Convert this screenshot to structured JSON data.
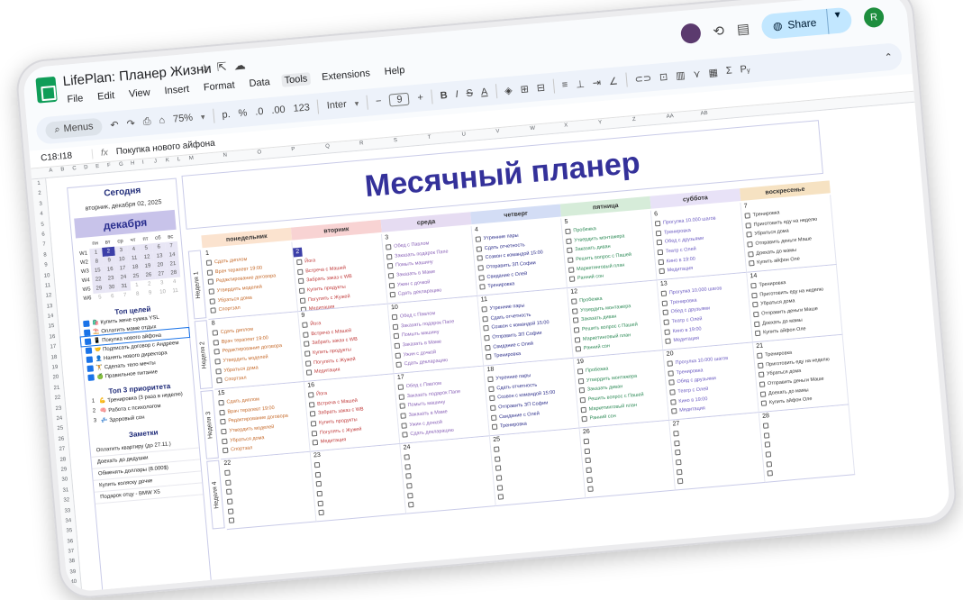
{
  "doc": {
    "title": "LifePlan: Планер Жизни",
    "menus": [
      "File",
      "Edit",
      "View",
      "Insert",
      "Format",
      "Data",
      "Tools",
      "Extensions",
      "Help"
    ],
    "active_menu": "Tools"
  },
  "right": {
    "share_label": "Share",
    "avatar_letter": "R"
  },
  "toolbar": {
    "search": "Menus",
    "zoom": "75%",
    "currency": "р.",
    "percent": "%",
    "dec_less": ".0",
    "dec_more": ".00",
    "format123": "123",
    "font": "Inter",
    "font_size": "9",
    "bold": "B",
    "italic": "I",
    "strike": "S",
    "text_color": "A",
    "function": "Σ"
  },
  "formula": {
    "cell_ref": "C18:I18",
    "fx": "fx",
    "content": "Покупка нового айфона"
  },
  "columns": [
    "A",
    "B",
    "C",
    "D",
    "E",
    "F",
    "G",
    "H",
    "I",
    "J",
    "K",
    "L",
    "M",
    "N",
    "O",
    "P",
    "Q",
    "R",
    "S",
    "T",
    "U",
    "V",
    "W",
    "X",
    "Y",
    "Z",
    "AA",
    "AB"
  ],
  "rows": [
    "1",
    "2",
    "3",
    "4",
    "5",
    "6",
    "7",
    "8",
    "9",
    "10",
    "11",
    "12",
    "13",
    "14",
    "15",
    "16",
    "17",
    "18",
    "19",
    "20",
    "21",
    "22",
    "23",
    "24",
    "25",
    "26",
    "27",
    "28",
    "29",
    "30",
    "31",
    "32",
    "33",
    "34",
    "35",
    "36",
    "37",
    "38",
    "39",
    "40",
    "41"
  ],
  "left": {
    "today_title": "Сегодня",
    "today_date": "вторник, декабря 02, 2025",
    "month": "декабря",
    "dow": [
      "пн",
      "вт",
      "ср",
      "чт",
      "пт",
      "сб",
      "вс"
    ],
    "weeks": [
      {
        "w": "W1",
        "d": [
          "1",
          "2",
          "3",
          "4",
          "5",
          "6",
          "7"
        ]
      },
      {
        "w": "W2",
        "d": [
          "8",
          "9",
          "10",
          "11",
          "12",
          "13",
          "14"
        ]
      },
      {
        "w": "W3",
        "d": [
          "15",
          "16",
          "17",
          "18",
          "19",
          "20",
          "21"
        ]
      },
      {
        "w": "W4",
        "d": [
          "22",
          "23",
          "24",
          "25",
          "26",
          "27",
          "28"
        ]
      },
      {
        "w": "W5",
        "d": [
          "29",
          "30",
          "31",
          "1",
          "2",
          "3",
          "4"
        ]
      },
      {
        "w": "W6",
        "d": [
          "5",
          "6",
          "7",
          "8",
          "9",
          "10",
          "11"
        ]
      }
    ],
    "goals_title": "Топ целей",
    "goals": [
      "🛍️ Купить жене сумка YSL",
      "⛱️ Оплатить маме отдых",
      "📱 Покупка нового айфона",
      "🤝 Подписать договор с Андреем",
      "👤 Нанять нового директора",
      "🏋️ Сделать тело мечты",
      "🍏 Правильное питание"
    ],
    "prio_title": "Топ 3 приоритета",
    "prios": [
      {
        "n": "1",
        "t": "💪 Тренировка (3 раза в неделю)"
      },
      {
        "n": "2",
        "t": "🧠 Работа с психологом"
      },
      {
        "n": "3",
        "t": "💤 Здоровый сон"
      }
    ],
    "notes_title": "Заметки",
    "notes": [
      "Оплатить квартиру (до 27.11.)",
      "Доехать до дедушки",
      "Обменять доллары (8.000$)",
      "Купить коляску дочке",
      "Подарок отцу - BMW X5"
    ]
  },
  "banner": "Месячный планер",
  "days": [
    {
      "name": "понедельник",
      "color": "#fbe3cf"
    },
    {
      "name": "вторник",
      "color": "#f8d3d3"
    },
    {
      "name": "среда",
      "color": "#e6dcf2"
    },
    {
      "name": "четверг",
      "color": "#d3ddf5"
    },
    {
      "name": "пятница",
      "color": "#d6ecd9"
    },
    {
      "name": "суббота",
      "color": "#e8e2f7"
    },
    {
      "name": "воскресенье",
      "color": "#f6e2c2"
    }
  ],
  "week_labels": [
    "Неделя 1",
    "Неделя 2",
    "Неделя 3",
    "Неделя 4"
  ],
  "tasks": [
    [
      "Сдать диплом",
      "Врач терапевт 19:00",
      "Редактирование договора",
      "Утвердить моделей",
      "Убраться дома",
      "Спортзал"
    ],
    [
      "Йога",
      "Встреча с Машей",
      "Забрать заказ с WB",
      "Купить продукты",
      "Погулять с Жужей",
      "Медитация"
    ],
    [
      "Обед с Павлом",
      "Заказать подарок Папе",
      "Помыть машину",
      "Заказать в Маме",
      "Ужин с дочкой",
      "Сдать декларацию"
    ],
    [
      "Утренние пары",
      "Сдать отчетность",
      "Созвон с командой 15:00",
      "Отправить ЗП Софии",
      "Свидание с Олей",
      "Тренировка"
    ],
    [
      "Пробежка",
      "Утвердить монтажера",
      "Заказать диван",
      "Решить вопрос с Пашей",
      "Маркетинговый план",
      "Ранний сон"
    ],
    [
      "Прогулка 10.000 шагов",
      "Тренировка",
      "Обед с друзьями",
      "Театр с Олей",
      "Кино в 19:00",
      "Медитация"
    ],
    [
      "Тренировка",
      "Приготовить еду на неделю",
      "Убраться дома",
      "Отправить деньги Маше",
      "Доехать до мамы",
      "Купить айфон Оле"
    ]
  ],
  "weeks": [
    [
      "1",
      "2",
      "3",
      "4",
      "5",
      "6",
      "7"
    ],
    [
      "8",
      "9",
      "10",
      "11",
      "12",
      "13",
      "14"
    ],
    [
      "15",
      "16",
      "17",
      "18",
      "19",
      "20",
      "21"
    ],
    [
      "22",
      "23",
      "24",
      "25",
      "26",
      "27",
      "28"
    ]
  ],
  "today_num": "2"
}
